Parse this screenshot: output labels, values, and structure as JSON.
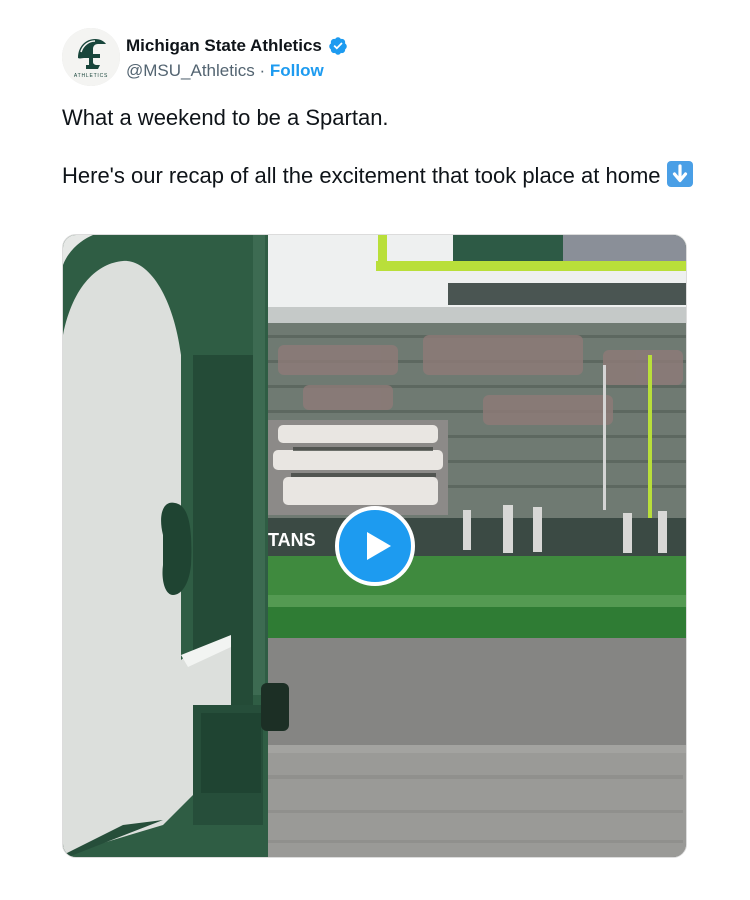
{
  "author": {
    "name": "Michigan State Athletics",
    "handle": "@MSU_Athletics",
    "separator": "·",
    "follow_label": "Follow",
    "verified": true,
    "avatar_text": "ATHLETICS"
  },
  "tweet": {
    "line1": "What a weekend to be a Spartan.",
    "line2": "Here's our recap of all the excitement that took place at home",
    "emoji": "down-arrow-emoji"
  },
  "media": {
    "type": "video",
    "play_icon": "play-icon",
    "scoreboard_text": "TANS"
  },
  "colors": {
    "accent": "#1d9bf0",
    "text": "#0f1419",
    "secondary": "#536471",
    "spartan_green": "#18453b"
  }
}
